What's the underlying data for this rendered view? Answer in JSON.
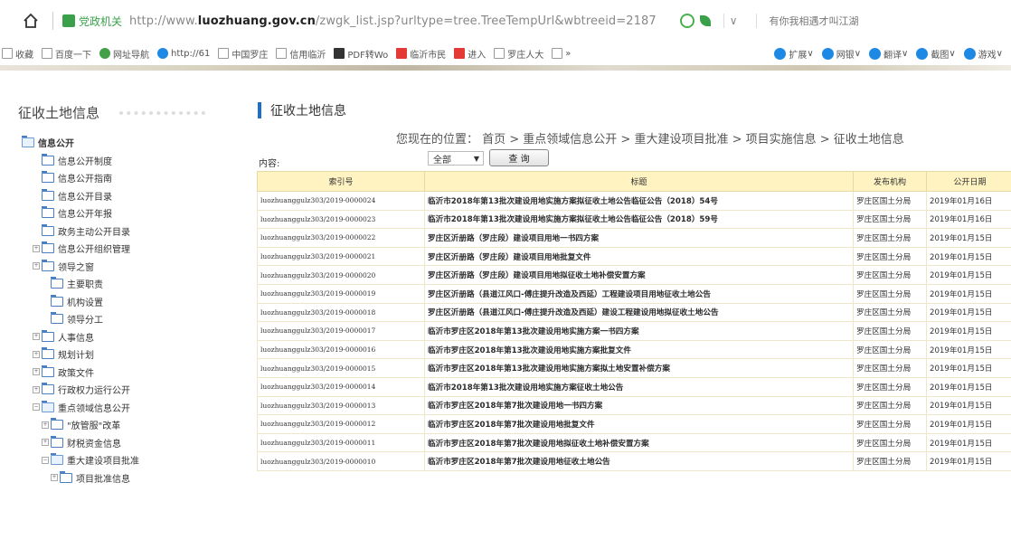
{
  "browser": {
    "site_name": "党政机关",
    "url_prefix": "http://www.",
    "url_domain": "luozhuang.gov.cn",
    "url_path": "/zwgk_list.jsp?urltype=tree.TreeTempUrl&wbtreeid=2187",
    "search_hint": "有你我相遇才叫江湖"
  },
  "bookmarks": [
    {
      "label": "收藏",
      "icon": "star-icon"
    },
    {
      "label": "百度一下",
      "icon": "page-icon"
    },
    {
      "label": "网址导航",
      "icon": "nav-icon"
    },
    {
      "label": "http://61",
      "icon": "globe-icon"
    },
    {
      "label": "中国罗庄",
      "icon": "page-icon"
    },
    {
      "label": "信用临沂",
      "icon": "page-icon"
    },
    {
      "label": "PDF转Wo",
      "icon": "pdf-icon"
    },
    {
      "label": "临沂市民",
      "icon": "red-icon"
    },
    {
      "label": "进入",
      "icon": "red-icon"
    },
    {
      "label": "罗庄人大",
      "icon": "page-icon"
    },
    {
      "label": "»",
      "icon": "more-icon"
    }
  ],
  "tools": [
    {
      "label": "扩展",
      "icon": "grid-icon"
    },
    {
      "label": "网银",
      "icon": "bank-icon"
    },
    {
      "label": "翻译",
      "icon": "translate-icon"
    },
    {
      "label": "截图",
      "icon": "screenshot-icon"
    },
    {
      "label": "游戏",
      "icon": "game-icon"
    }
  ],
  "sidebar": {
    "title": "征收土地信息",
    "items": [
      {
        "label": "信息公开",
        "level": 0,
        "expandable": false,
        "open": true
      },
      {
        "label": "信息公开制度",
        "level": 1
      },
      {
        "label": "信息公开指南",
        "level": 1
      },
      {
        "label": "信息公开目录",
        "level": 1
      },
      {
        "label": "信息公开年报",
        "level": 1
      },
      {
        "label": "政务主动公开目录",
        "level": 1
      },
      {
        "label": "信息公开组织管理",
        "level": 1,
        "expandable": true
      },
      {
        "label": "领导之窗",
        "level": 1,
        "expandable": true
      },
      {
        "label": "主要职责",
        "level": 2
      },
      {
        "label": "机构设置",
        "level": 2
      },
      {
        "label": "领导分工",
        "level": 2
      },
      {
        "label": "人事信息",
        "level": 1,
        "expandable": true
      },
      {
        "label": "规划计划",
        "level": 1,
        "expandable": true
      },
      {
        "label": "政策文件",
        "level": 1,
        "expandable": true
      },
      {
        "label": "行政权力运行公开",
        "level": 1,
        "expandable": true
      },
      {
        "label": "重点领域信息公开",
        "level": 1,
        "expandable": true,
        "open": true
      },
      {
        "label": "\"放管服\"改革",
        "level": 2,
        "expandable": true
      },
      {
        "label": "财税资金信息",
        "level": 2,
        "expandable": true
      },
      {
        "label": "重大建设项目批准",
        "level": 2,
        "expandable": true,
        "open": true
      },
      {
        "label": "项目批准信息",
        "level": 3,
        "expandable": true
      }
    ]
  },
  "main": {
    "title": "征收土地信息",
    "breadcrumb": "您现在的位置： 首页 > 重点领域信息公开 > 重大建设项目批准 > 项目实施信息 > 征收土地信息",
    "filter_label": "内容:",
    "filter_value": "全部",
    "query_label": "查 询",
    "columns": [
      "索引号",
      "标题",
      "发布机构",
      "公开日期"
    ],
    "rows": [
      [
        "luozhuanggulz303/2019-0000024",
        "临沂市2018年第13批次建设用地实施方案拟征收土地公告临征公告（2018）54号",
        "罗庄区国土分局",
        "2019年01月16日"
      ],
      [
        "luozhuanggulz303/2019-0000023",
        "临沂市2018年第13批次建设用地实施方案拟征收土地公告临征公告（2018）59号",
        "罗庄区国土分局",
        "2019年01月16日"
      ],
      [
        "luozhuanggulz303/2019-0000022",
        "罗庄区沂册路（罗庄段）建设项目用地一书四方案",
        "罗庄区国土分局",
        "2019年01月15日"
      ],
      [
        "luozhuanggulz303/2019-0000021",
        "罗庄区沂册路（罗庄段）建设项目用地批复文件",
        "罗庄区国土分局",
        "2019年01月15日"
      ],
      [
        "luozhuanggulz303/2019-0000020",
        "罗庄区沂册路（罗庄段）建设项目用地拟征收土地补偿安置方案",
        "罗庄区国土分局",
        "2019年01月15日"
      ],
      [
        "luozhuanggulz303/2019-0000019",
        "罗庄区沂册路（县道江风口-傅庄提升改造及西延）工程建设项目用地征收土地公告",
        "罗庄区国土分局",
        "2019年01月15日"
      ],
      [
        "luozhuanggulz303/2019-0000018",
        "罗庄区沂册路（县道江风口-傅庄提升改造及西延）建设工程建设用地拟征收土地公告",
        "罗庄区国土分局",
        "2019年01月15日"
      ],
      [
        "luozhuanggulz303/2019-0000017",
        "临沂市罗庄区2018年第13批次建设用地实施方案一书四方案",
        "罗庄区国土分局",
        "2019年01月15日"
      ],
      [
        "luozhuanggulz303/2019-0000016",
        "临沂市罗庄区2018年第13批次建设用地实施方案批复文件",
        "罗庄区国土分局",
        "2019年01月15日"
      ],
      [
        "luozhuanggulz303/2019-0000015",
        "临沂市罗庄区2018年第13批次建设用地实施方案拟土地安置补偿方案",
        "罗庄区国土分局",
        "2019年01月15日"
      ],
      [
        "luozhuanggulz303/2019-0000014",
        "临沂市2018年第13批次建设用地实施方案征收土地公告",
        "罗庄区国土分局",
        "2019年01月15日"
      ],
      [
        "luozhuanggulz303/2019-0000013",
        "临沂市罗庄区2018年第7批次建设用地一书四方案",
        "罗庄区国土分局",
        "2019年01月15日"
      ],
      [
        "luozhuanggulz303/2019-0000012",
        "临沂市罗庄区2018年第7批次建设用地批复文件",
        "罗庄区国土分局",
        "2019年01月15日"
      ],
      [
        "luozhuanggulz303/2019-0000011",
        "临沂市罗庄区2018年第7批次建设用地拟征收土地补偿安置方案",
        "罗庄区国土分局",
        "2019年01月15日"
      ],
      [
        "luozhuanggulz303/2019-0000010",
        "临沂市罗庄区2018年第7批次建设用地征收土地公告",
        "罗庄区国土分局",
        "2019年01月15日"
      ]
    ]
  },
  "colors": {
    "accent": "#1e6fc9",
    "header_bg": "#fff3c2",
    "site_green": "#3aa14a"
  }
}
